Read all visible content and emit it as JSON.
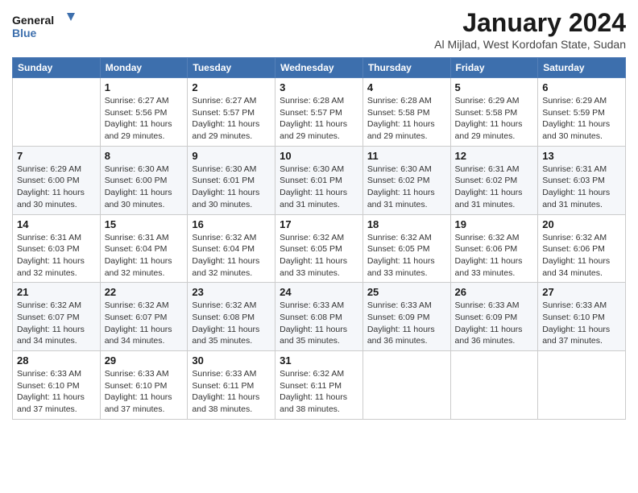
{
  "logo": {
    "name": "General",
    "name2": "Blue"
  },
  "title": "January 2024",
  "subtitle": "Al Mijlad, West Kordofan State, Sudan",
  "header_days": [
    "Sunday",
    "Monday",
    "Tuesday",
    "Wednesday",
    "Thursday",
    "Friday",
    "Saturday"
  ],
  "weeks": [
    [
      {
        "day": "",
        "info": ""
      },
      {
        "day": "1",
        "info": "Sunrise: 6:27 AM\nSunset: 5:56 PM\nDaylight: 11 hours\nand 29 minutes."
      },
      {
        "day": "2",
        "info": "Sunrise: 6:27 AM\nSunset: 5:57 PM\nDaylight: 11 hours\nand 29 minutes."
      },
      {
        "day": "3",
        "info": "Sunrise: 6:28 AM\nSunset: 5:57 PM\nDaylight: 11 hours\nand 29 minutes."
      },
      {
        "day": "4",
        "info": "Sunrise: 6:28 AM\nSunset: 5:58 PM\nDaylight: 11 hours\nand 29 minutes."
      },
      {
        "day": "5",
        "info": "Sunrise: 6:29 AM\nSunset: 5:58 PM\nDaylight: 11 hours\nand 29 minutes."
      },
      {
        "day": "6",
        "info": "Sunrise: 6:29 AM\nSunset: 5:59 PM\nDaylight: 11 hours\nand 30 minutes."
      }
    ],
    [
      {
        "day": "7",
        "info": "Sunrise: 6:29 AM\nSunset: 6:00 PM\nDaylight: 11 hours\nand 30 minutes."
      },
      {
        "day": "8",
        "info": "Sunrise: 6:30 AM\nSunset: 6:00 PM\nDaylight: 11 hours\nand 30 minutes."
      },
      {
        "day": "9",
        "info": "Sunrise: 6:30 AM\nSunset: 6:01 PM\nDaylight: 11 hours\nand 30 minutes."
      },
      {
        "day": "10",
        "info": "Sunrise: 6:30 AM\nSunset: 6:01 PM\nDaylight: 11 hours\nand 31 minutes."
      },
      {
        "day": "11",
        "info": "Sunrise: 6:30 AM\nSunset: 6:02 PM\nDaylight: 11 hours\nand 31 minutes."
      },
      {
        "day": "12",
        "info": "Sunrise: 6:31 AM\nSunset: 6:02 PM\nDaylight: 11 hours\nand 31 minutes."
      },
      {
        "day": "13",
        "info": "Sunrise: 6:31 AM\nSunset: 6:03 PM\nDaylight: 11 hours\nand 31 minutes."
      }
    ],
    [
      {
        "day": "14",
        "info": "Sunrise: 6:31 AM\nSunset: 6:03 PM\nDaylight: 11 hours\nand 32 minutes."
      },
      {
        "day": "15",
        "info": "Sunrise: 6:31 AM\nSunset: 6:04 PM\nDaylight: 11 hours\nand 32 minutes."
      },
      {
        "day": "16",
        "info": "Sunrise: 6:32 AM\nSunset: 6:04 PM\nDaylight: 11 hours\nand 32 minutes."
      },
      {
        "day": "17",
        "info": "Sunrise: 6:32 AM\nSunset: 6:05 PM\nDaylight: 11 hours\nand 33 minutes."
      },
      {
        "day": "18",
        "info": "Sunrise: 6:32 AM\nSunset: 6:05 PM\nDaylight: 11 hours\nand 33 minutes."
      },
      {
        "day": "19",
        "info": "Sunrise: 6:32 AM\nSunset: 6:06 PM\nDaylight: 11 hours\nand 33 minutes."
      },
      {
        "day": "20",
        "info": "Sunrise: 6:32 AM\nSunset: 6:06 PM\nDaylight: 11 hours\nand 34 minutes."
      }
    ],
    [
      {
        "day": "21",
        "info": "Sunrise: 6:32 AM\nSunset: 6:07 PM\nDaylight: 11 hours\nand 34 minutes."
      },
      {
        "day": "22",
        "info": "Sunrise: 6:32 AM\nSunset: 6:07 PM\nDaylight: 11 hours\nand 34 minutes."
      },
      {
        "day": "23",
        "info": "Sunrise: 6:32 AM\nSunset: 6:08 PM\nDaylight: 11 hours\nand 35 minutes."
      },
      {
        "day": "24",
        "info": "Sunrise: 6:33 AM\nSunset: 6:08 PM\nDaylight: 11 hours\nand 35 minutes."
      },
      {
        "day": "25",
        "info": "Sunrise: 6:33 AM\nSunset: 6:09 PM\nDaylight: 11 hours\nand 36 minutes."
      },
      {
        "day": "26",
        "info": "Sunrise: 6:33 AM\nSunset: 6:09 PM\nDaylight: 11 hours\nand 36 minutes."
      },
      {
        "day": "27",
        "info": "Sunrise: 6:33 AM\nSunset: 6:10 PM\nDaylight: 11 hours\nand 37 minutes."
      }
    ],
    [
      {
        "day": "28",
        "info": "Sunrise: 6:33 AM\nSunset: 6:10 PM\nDaylight: 11 hours\nand 37 minutes."
      },
      {
        "day": "29",
        "info": "Sunrise: 6:33 AM\nSunset: 6:10 PM\nDaylight: 11 hours\nand 37 minutes."
      },
      {
        "day": "30",
        "info": "Sunrise: 6:33 AM\nSunset: 6:11 PM\nDaylight: 11 hours\nand 38 minutes."
      },
      {
        "day": "31",
        "info": "Sunrise: 6:32 AM\nSunset: 6:11 PM\nDaylight: 11 hours\nand 38 minutes."
      },
      {
        "day": "",
        "info": ""
      },
      {
        "day": "",
        "info": ""
      },
      {
        "day": "",
        "info": ""
      }
    ]
  ]
}
